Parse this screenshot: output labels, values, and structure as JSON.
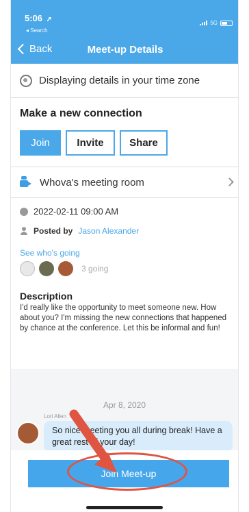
{
  "status_bar": {
    "time": "5:06",
    "location_glyph": "◂",
    "back_app": "◂ Search",
    "carrier": "5G"
  },
  "nav": {
    "back_label": "Back",
    "title": "Meet-up Details"
  },
  "timezone": {
    "text": "Displaying details in your time zone",
    "icon": "globe-icon"
  },
  "connection": {
    "title": "Make a new connection",
    "buttons": [
      "Join",
      "Invite",
      "Share"
    ]
  },
  "room": {
    "label": "Whova's meeting room",
    "icon": "video-camera-icon"
  },
  "details": {
    "datetime": "2022-02-11 09:00 AM",
    "posted_prefix": "Posted by",
    "posted_by": "Jason Alexander",
    "see_going": "See who's going",
    "going_count": "3 going",
    "description_title": "Description",
    "description": "I'd really like the opportunity to meet someone new. How about you? I'm missing the new connections that happened by chance at the conference. Let this be informal and fun!"
  },
  "chat": {
    "date": "Apr 8, 2020",
    "sender": "Lori Allen",
    "message": "So nice meeting you all during break! Have a great rest of your day!"
  },
  "cta": {
    "label": "Join Meet-up"
  },
  "colors": {
    "accent": "#4aa7e8",
    "annotation": "#e05442"
  }
}
